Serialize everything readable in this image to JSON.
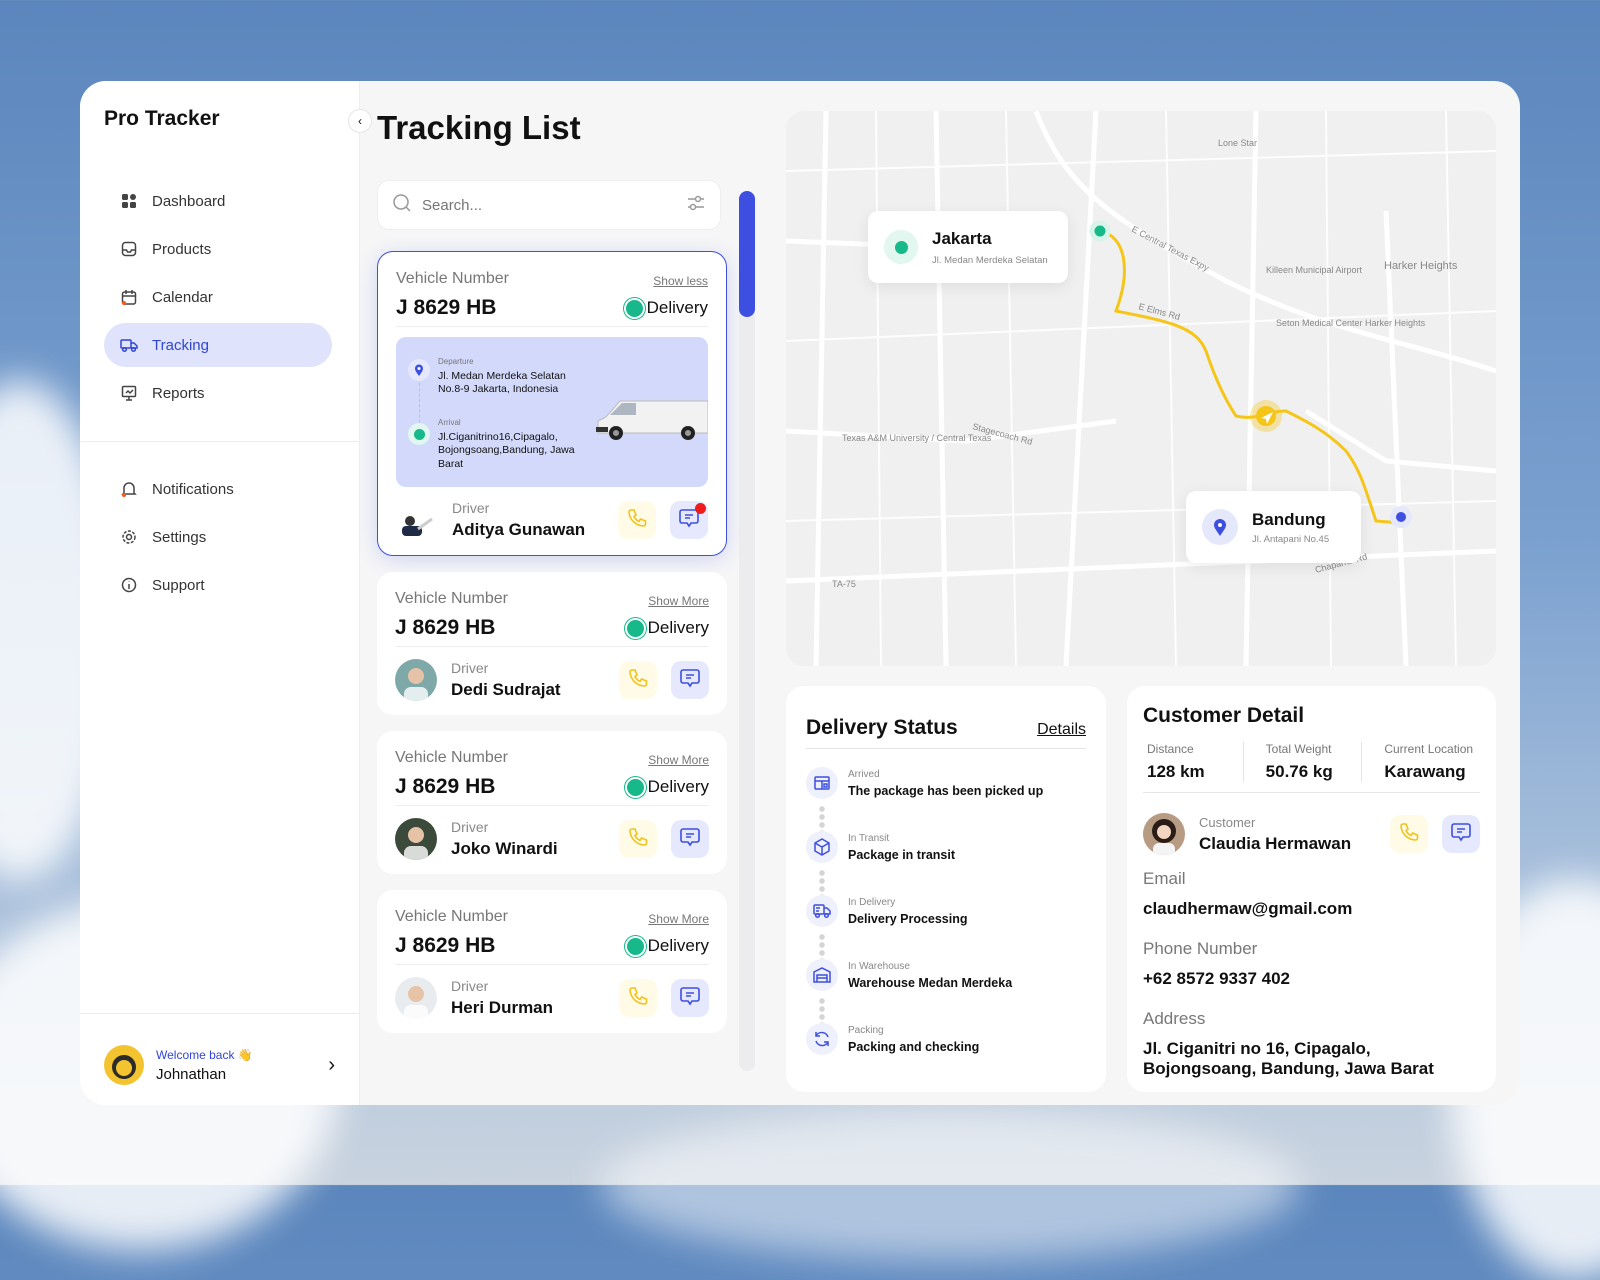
{
  "app": {
    "name": "Pro Tracker",
    "accent": "#3d4fe0",
    "status_color": "#17b889"
  },
  "sidebar": {
    "items": [
      {
        "label": "Dashboard",
        "icon": "grid-icon"
      },
      {
        "label": "Products",
        "icon": "inbox-icon"
      },
      {
        "label": "Calendar",
        "icon": "calendar-icon"
      },
      {
        "label": "Tracking",
        "icon": "truck-icon",
        "active": true
      },
      {
        "label": "Reports",
        "icon": "presentation-icon"
      }
    ],
    "secondary": [
      {
        "label": "Notifications",
        "icon": "bell-icon"
      },
      {
        "label": "Settings",
        "icon": "gear-icon"
      },
      {
        "label": "Support",
        "icon": "info-icon"
      }
    ],
    "welcome": "Welcome back 👋",
    "user": "Johnathan"
  },
  "page": {
    "title": "Tracking List"
  },
  "search": {
    "placeholder": "Search...",
    "value": ""
  },
  "vehicles": [
    {
      "label": "Vehicle Number",
      "number": "J 8629 HB",
      "status": "Delivery",
      "toggle": "Show less",
      "driver_label": "Driver",
      "driver": "Aditya Gunawan",
      "departure_label": "Departure",
      "departure": "Jl. Medan Merdeka Selatan No.8-9 Jakarta, Indonesia",
      "arrival_label": "Arrival",
      "arrival": "Jl.Ciganitrino16,Cipagalo, Bojongsoang,Bandung, Jawa Barat"
    },
    {
      "label": "Vehicle Number",
      "number": "J 8629 HB",
      "status": "Delivery",
      "toggle": "Show More",
      "driver_label": "Driver",
      "driver": "Dedi Sudrajat"
    },
    {
      "label": "Vehicle Number",
      "number": "J 8629 HB",
      "status": "Delivery",
      "toggle": "Show More",
      "driver_label": "Driver",
      "driver": "Joko Winardi"
    },
    {
      "label": "Vehicle Number",
      "number": "J 8629 HB",
      "status": "Delivery",
      "toggle": "Show More",
      "driver_label": "Driver",
      "driver": "Heri Durman"
    }
  ],
  "map": {
    "origin": {
      "city": "Jakarta",
      "address": "Jl. Medan Merdeka Selatan"
    },
    "destination": {
      "city": "Bandung",
      "address": "Jl. Antapani No.45"
    },
    "labels": [
      "Harker Heights",
      "Killeen Municipal Airport",
      "Seton Medical Center Harker Heights",
      "Texas A&M University / Central Texas",
      "Lone Star",
      "E Central Texas Expy",
      "Stagecoach Rd",
      "E Elms Rd",
      "Chaparral Rd",
      "TA-75"
    ],
    "route_color": "#f5c518"
  },
  "delivery_status": {
    "title": "Delivery Status",
    "details_link": "Details",
    "steps": [
      {
        "label": "Arrived",
        "text": "The package has been picked up",
        "icon": "package-box-icon"
      },
      {
        "label": "In Transit",
        "text": "Package in transit",
        "icon": "cube-icon"
      },
      {
        "label": "In Delivery",
        "text": "Delivery Processing",
        "icon": "truck-icon"
      },
      {
        "label": "In Warehouse",
        "text": "Warehouse Medan Merdeka",
        "icon": "warehouse-icon"
      },
      {
        "label": "Packing",
        "text": "Packing and checking",
        "icon": "refresh-icon"
      }
    ]
  },
  "customer": {
    "title": "Customer Detail",
    "stats": [
      {
        "label": "Distance",
        "value": "128 km"
      },
      {
        "label": "Total Weight",
        "value": "50.76 kg"
      },
      {
        "label": "Current Location",
        "value": "Karawang"
      }
    ],
    "customer_label": "Customer",
    "name": "Claudia Hermawan",
    "email_label": "Email",
    "email": "claudhermaw@gmail.com",
    "phone_label": "Phone Number",
    "phone": "+62 8572 9337 402",
    "address_label": "Address",
    "address": "Jl. Ciganitri no 16, Cipagalo, Bojongsoang, Bandung, Jawa Barat"
  }
}
